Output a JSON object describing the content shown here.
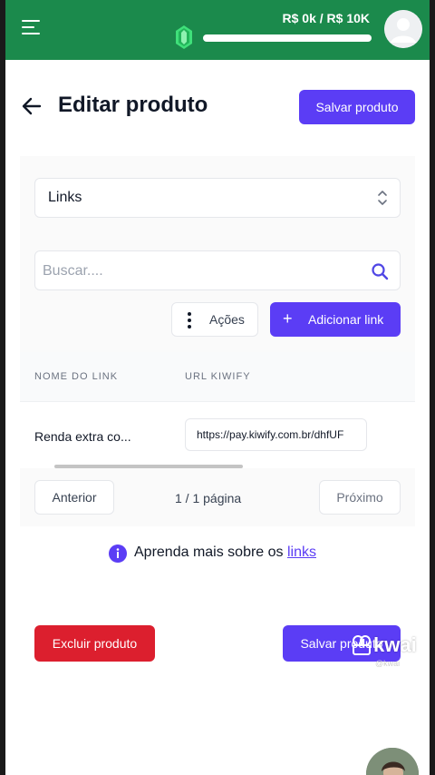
{
  "header": {
    "revenue_text": "R$ 0k / R$ 10K",
    "progress_fraction": 0.0,
    "colors": {
      "bar": "#1b8a4c",
      "gem": "#3fe07a"
    }
  },
  "page": {
    "title": "Editar produto",
    "save_label": "Salvar produto"
  },
  "section_select": {
    "value": "Links"
  },
  "search": {
    "placeholder": "Buscar...."
  },
  "toolbar": {
    "actions_label": "Ações",
    "add_link_label": "Adicionar link",
    "add_icon": "+"
  },
  "table": {
    "columns": [
      "NOME DO LINK",
      "URL KIWIFY"
    ],
    "rows": [
      {
        "name": "Renda extra co...",
        "url": "https://pay.kiwify.com.br/dhfUF"
      }
    ]
  },
  "pagination": {
    "prev_label": "Anterior",
    "page_info": "1 / 1 página",
    "next_label": "Próximo"
  },
  "info": {
    "text": "Aprenda mais sobre os ",
    "link_label": "links"
  },
  "footer": {
    "delete_label": "Excluir produto",
    "save_label": "Salvar produto"
  },
  "watermark": {
    "brand": "kwai",
    "handle": "@kwai"
  },
  "accent_color": "#5b3df5",
  "danger_color": "#dc1f2e"
}
